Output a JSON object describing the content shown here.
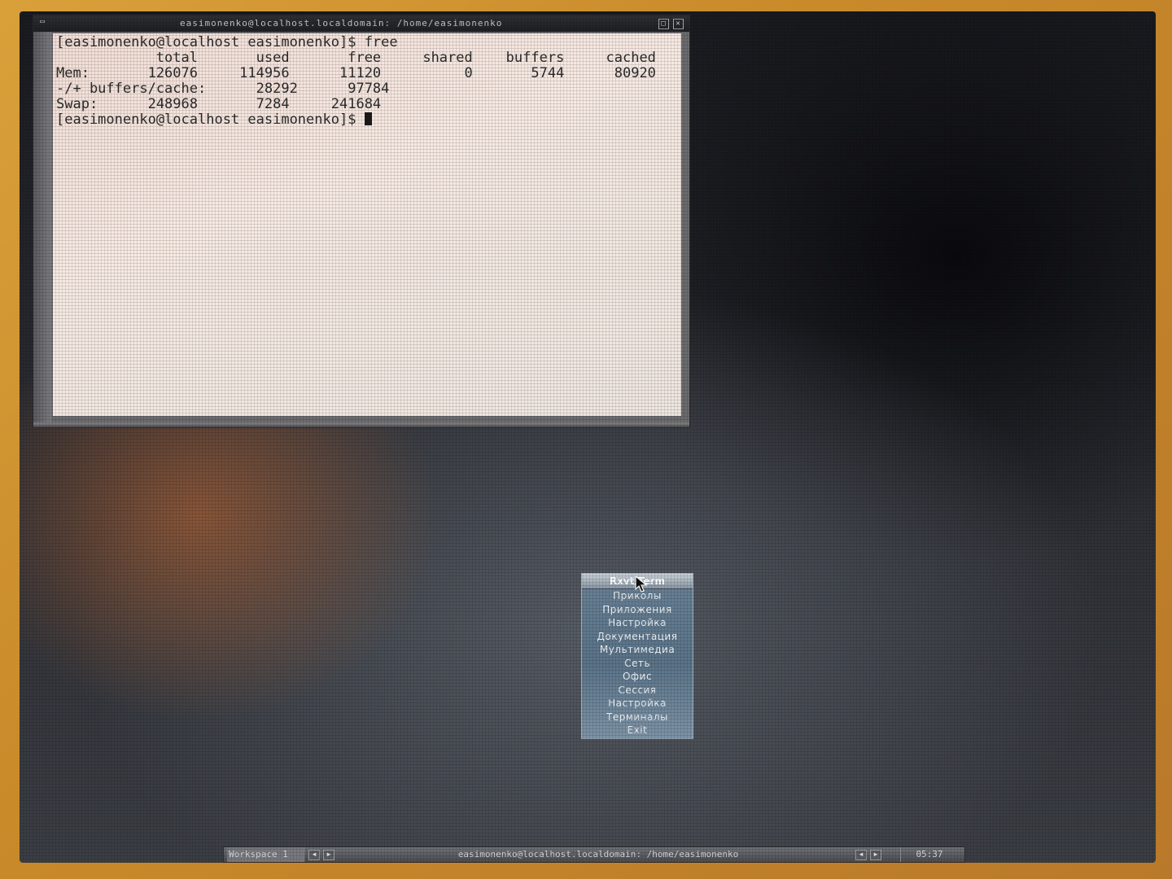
{
  "terminal": {
    "window_title": "easimonenko@localhost.localdomain: /home/easimonenko",
    "lines": [
      "[easimonenko@localhost easimonenko]$ free",
      "            total       used       free     shared    buffers     cached",
      "Mem:       126076     114956      11120          0       5744      80920",
      "-/+ buffers/cache:      28292      97784",
      "Swap:      248968       7284     241684"
    ],
    "prompt": "[easimonenko@localhost easimonenko]$ "
  },
  "root_menu": {
    "title": "Rxvt/Term",
    "items": [
      "Приколы",
      "Приложения",
      "Настройка",
      "Документация",
      "Мультимедиа",
      "Сеть",
      "Офис",
      "Сессия",
      "Настройка",
      "Терминалы",
      "Exit"
    ]
  },
  "taskbar": {
    "workspace": "Workspace 1",
    "task_title": "easimonenko@localhost.localdomain: /home/easimonenko",
    "clock": "05:37"
  },
  "icons": [
    "window-menu-icon",
    "maximize-icon",
    "close-icon",
    "mouse-cursor-icon",
    "arrow-left-icon",
    "arrow-right-icon"
  ]
}
